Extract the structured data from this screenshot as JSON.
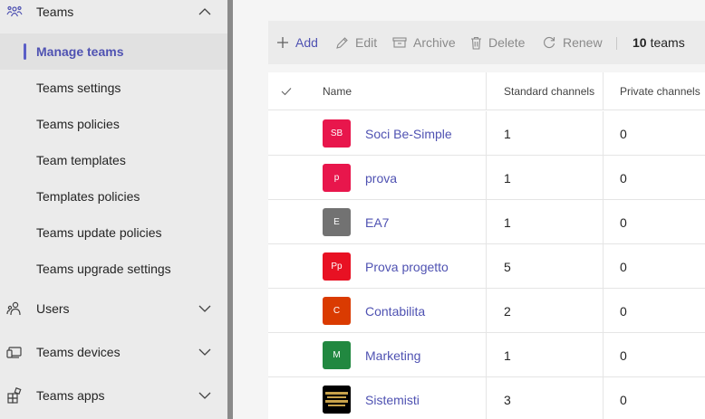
{
  "sidebar": {
    "teams": {
      "label": "Teams",
      "icon": "teams-icon"
    },
    "sub_items": [
      {
        "label": "Manage teams",
        "active": true
      },
      {
        "label": "Teams settings"
      },
      {
        "label": "Teams policies"
      },
      {
        "label": "Team templates"
      },
      {
        "label": "Templates policies"
      },
      {
        "label": "Teams update policies"
      },
      {
        "label": "Teams upgrade settings"
      }
    ],
    "users": {
      "label": "Users",
      "icon": "users-icon"
    },
    "devices": {
      "label": "Teams devices",
      "icon": "devices-icon"
    },
    "apps": {
      "label": "Teams apps",
      "icon": "apps-icon"
    }
  },
  "toolbar": {
    "add": "Add",
    "edit": "Edit",
    "archive": "Archive",
    "delete": "Delete",
    "renew": "Renew",
    "count_number": "10",
    "count_label": "teams"
  },
  "table": {
    "columns": {
      "name": "Name",
      "standard": "Standard channels",
      "private": "Private channels"
    },
    "rows": [
      {
        "initials": "SB",
        "color": "#e8164c",
        "name": "Soci Be-Simple",
        "standard": "1",
        "private": "0"
      },
      {
        "initials": "p",
        "color": "#e8164c",
        "name": "prova",
        "standard": "1",
        "private": "0"
      },
      {
        "initials": "E",
        "color": "#727272",
        "name": "EA7",
        "standard": "1",
        "private": "0"
      },
      {
        "initials": "Pp",
        "color": "#e81123",
        "name": "Prova progetto",
        "standard": "5",
        "private": "0"
      },
      {
        "initials": "C",
        "color": "#da3b01",
        "name": "Contabilita",
        "standard": "2",
        "private": "0"
      },
      {
        "initials": "M",
        "color": "#218840",
        "name": "Marketing",
        "standard": "1",
        "private": "0"
      },
      {
        "initials": "",
        "color": "#000000",
        "name": "Sistemisti",
        "standard": "3",
        "private": "0"
      }
    ]
  },
  "colors": {
    "accent": "#4f52b2",
    "sidebar_bg": "#ebebeb"
  }
}
